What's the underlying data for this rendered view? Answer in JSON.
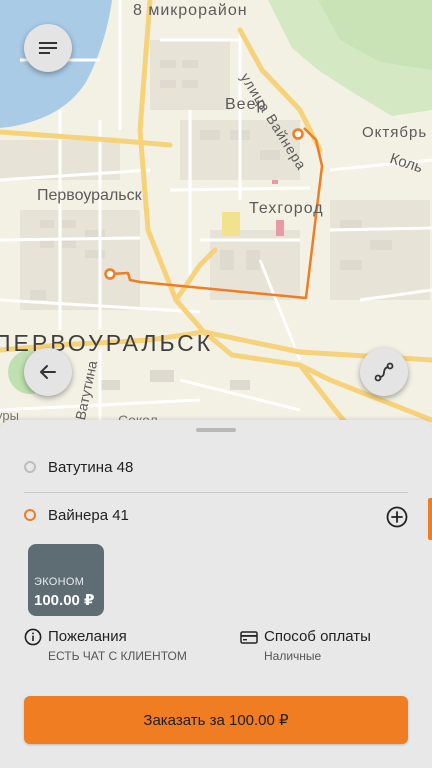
{
  "map": {
    "labels": {
      "microdistrict": "8 микрорайон",
      "veer": "Веер",
      "oktyabr": "Октябрь",
      "kolts": "Коль",
      "city_small": "Первоуральск",
      "tehgorod": "Техгород",
      "city_big": "ПЕРВОУРАЛЬСК",
      "vainera_street": "улица Вайнера",
      "vatutina_street": "Ватутина",
      "ury": "уры",
      "sokol": "Сокол"
    },
    "route_color": "#f07d22"
  },
  "buttons": {
    "menu_icon": "menu-icon",
    "back_icon": "arrow-left-icon",
    "route_icon": "route-icon"
  },
  "sheet": {
    "from": "Ватутина 48",
    "to": "Вайнера 41",
    "tariff": {
      "name": "ЭКОНОМ",
      "price": "100.00 ₽"
    },
    "wishes": {
      "title": "Пожелания",
      "subtitle": "ЕСТЬ ЧАТ С КЛИЕНТОМ"
    },
    "payment": {
      "title": "Способ оплаты",
      "subtitle": "Наличные"
    },
    "order_label": "Заказать за 100.00 ₽"
  }
}
